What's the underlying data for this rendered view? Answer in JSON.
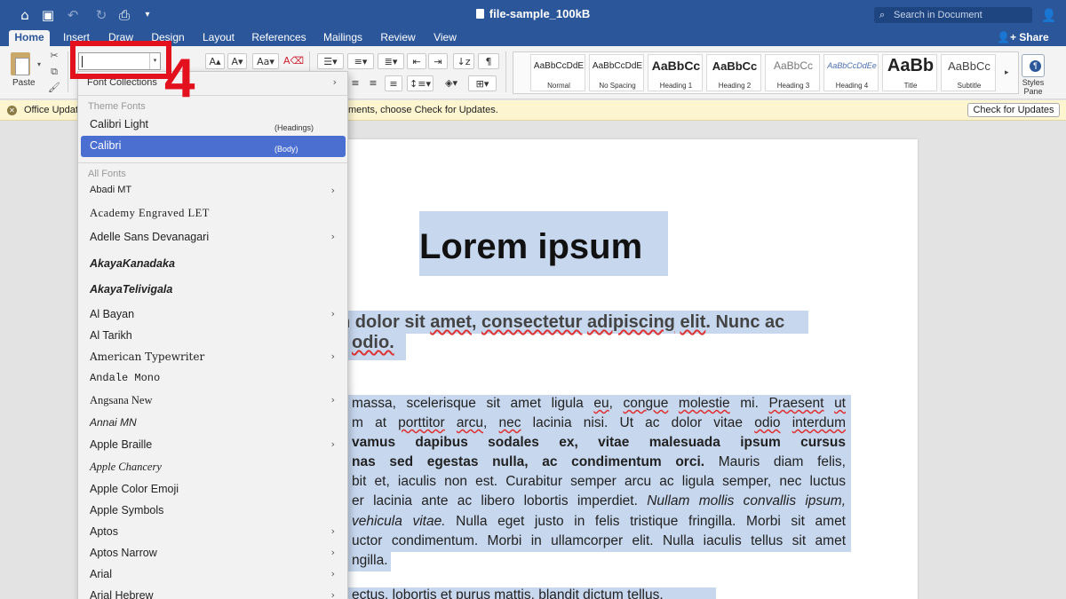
{
  "window": {
    "title": "file-sample_100kB"
  },
  "search": {
    "placeholder": "Search in Document"
  },
  "tabs": [
    {
      "label": "Home",
      "active": true
    },
    {
      "label": "Insert"
    },
    {
      "label": "Draw"
    },
    {
      "label": "Design"
    },
    {
      "label": "Layout"
    },
    {
      "label": "References"
    },
    {
      "label": "Mailings"
    },
    {
      "label": "Review"
    },
    {
      "label": "View"
    }
  ],
  "share": {
    "label": "Share"
  },
  "ribbon": {
    "paste_label": "Paste",
    "font_input_value": "",
    "styles_pane_label": "Styles Pane",
    "styles": [
      {
        "preview": "AaBbCcDdE",
        "label": "Normal"
      },
      {
        "preview": "AaBbCcDdE",
        "label": "No Spacing"
      },
      {
        "preview": "AaBbCc",
        "label": "Heading 1"
      },
      {
        "preview": "AaBbCc",
        "label": "Heading 2"
      },
      {
        "preview": "AaBbCc",
        "label": "Heading 3"
      },
      {
        "preview": "AaBbCcDdEe",
        "label": "Heading 4"
      },
      {
        "preview": "AaBb",
        "label": "Title"
      },
      {
        "preview": "AaBbCc",
        "label": "Subtitle"
      }
    ]
  },
  "annotation": {
    "step": "4"
  },
  "update_bar": {
    "left_text": "Office Updat",
    "right_text": "ments, choose Check for Updates.",
    "button": "Check for Updates"
  },
  "font_menu": {
    "collections": "Font Collections",
    "theme_fonts_header": "Theme Fonts",
    "theme_fonts": [
      {
        "name": "Calibri Light",
        "note": "(Headings)"
      },
      {
        "name": "Calibri",
        "note": "(Body)",
        "selected": true
      }
    ],
    "all_fonts_header": "All Fonts",
    "fonts": [
      {
        "name": "Abadi MT",
        "sub": true
      },
      {
        "name": "Academy Engraved LET"
      },
      {
        "name": "Adelle Sans Devanagari",
        "sub": true
      },
      {
        "name": "AkayaKanadaka"
      },
      {
        "name": "AkayaTelivigala"
      },
      {
        "name": "Al Bayan",
        "sub": true
      },
      {
        "name": "Al Tarikh"
      },
      {
        "name": "American Typewriter",
        "sub": true
      },
      {
        "name": "Andale Mono"
      },
      {
        "name": "Angsana New",
        "sub": true
      },
      {
        "name": "Annai MN"
      },
      {
        "name": "Apple Braille",
        "sub": true
      },
      {
        "name": "Apple Chancery"
      },
      {
        "name": "Apple Color Emoji"
      },
      {
        "name": "Apple Symbols"
      },
      {
        "name": "Aptos",
        "sub": true
      },
      {
        "name": "Aptos Narrow",
        "sub": true
      },
      {
        "name": "Arial",
        "sub": true
      },
      {
        "name": "Arial Hebrew",
        "sub": true
      }
    ]
  },
  "document": {
    "heading": "Lorem ipsum",
    "subheading": [
      "n dolor sit amet, consectetur adipiscing elit. Nunc ac",
      "odio."
    ],
    "body": [
      "massa, scelerisque sit amet ligula eu, congue molestie mi. Praesent ut",
      "m at porttitor arcu, nec lacinia nisi. Ut ac dolor vitae odio interdum",
      "vamus dapibus sodales ex, vitae malesuada ipsum cursus",
      "nas sed egestas nulla, ac condimentum orci. Mauris diam felis,",
      "bit et, iaculis non est. Curabitur semper arcu ac ligula semper, nec luctus",
      "er lacinia ante ac libero lobortis imperdiet. Nullam mollis convallis ipsum,",
      " vehicula vitae. Nulla eget justo in felis tristique fringilla. Morbi sit amet",
      "uctor condimentum. Morbi in ullamcorper elit. Nulla iaculis tellus sit amet",
      "ngilla.",
      "ectus, lobortis et purus mattis, blandit dictum tellus."
    ],
    "body_parts": {
      "l1": [
        "massa, scelerisque sit amet ligula ",
        "eu",
        ", ",
        "congue",
        " ",
        "molestie",
        " mi. ",
        "Praesent",
        " ",
        "ut"
      ],
      "l2": [
        "m at ",
        "porttitor",
        " ",
        "arcu",
        ", ",
        "nec",
        " lacinia nisi. Ut ac dolor vitae ",
        "odio",
        " ",
        "interdum"
      ],
      "l3_bold": "vamus dapibus sodales ex, vitae malesuada ipsum cursus",
      "l4_bold": "nas sed egestas nulla, ac condimentum orci.",
      "l4_rest": " Mauris diam felis,",
      "l6_plain": "er lacinia ante ac libero lobortis imperdiet. ",
      "l6_italic": "Nullam mollis convallis ipsum,",
      "l7_italic": " vehicula vitae.",
      "l7_rest": " Nulla eget justo in felis tristique fringilla. Morbi sit amet"
    }
  }
}
